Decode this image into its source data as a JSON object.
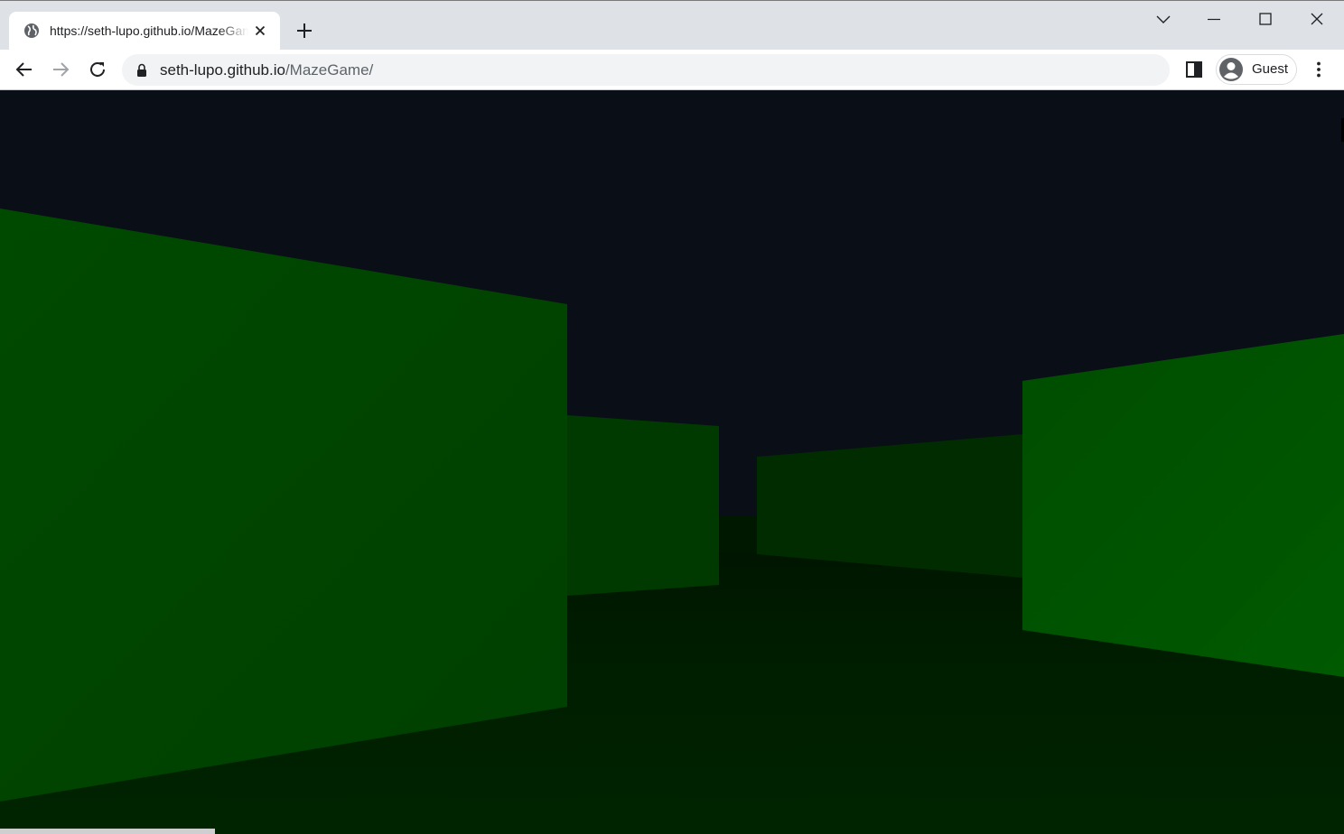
{
  "browser": {
    "tab": {
      "title": "https://seth-lupo.github.io/MazeGame/",
      "favicon": "globe-icon"
    },
    "address": {
      "host": "seth-lupo.github.io",
      "path": "/MazeGame/"
    },
    "profile": {
      "label": "Guest"
    },
    "icons": {
      "close": "close-icon",
      "new_tab": "plus-icon",
      "back": "arrow-left-icon",
      "forward": "arrow-right-icon",
      "reload": "reload-icon",
      "lock": "lock-icon",
      "side_panel": "side-panel-icon",
      "menu": "kebab-menu-icon",
      "tab_search": "chevron-down-icon",
      "minimize": "minimize-icon",
      "maximize": "maximize-icon",
      "window_close": "window-close-icon"
    }
  },
  "scene": {
    "sky_color": "#0a0e16",
    "floor_color": "#001f00",
    "near_wall_color": "#004400",
    "right_wall_color": "#005300",
    "far_wall_color": "#002a00"
  }
}
